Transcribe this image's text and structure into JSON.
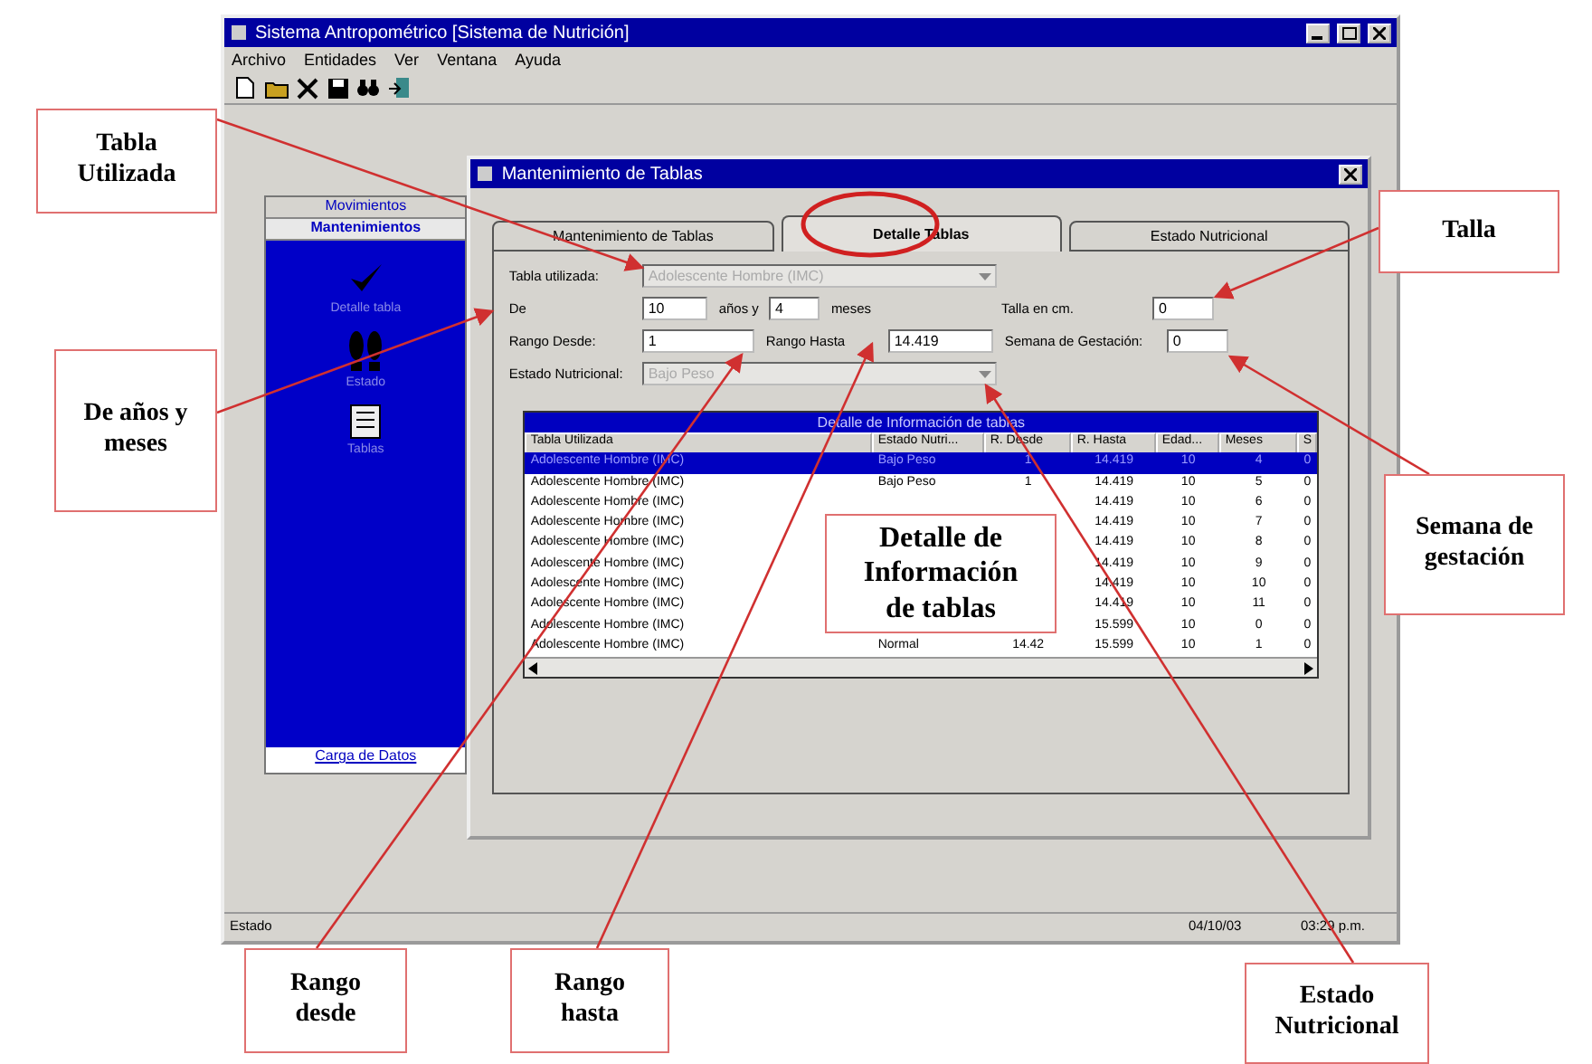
{
  "window": {
    "title": "Sistema Antropométrico [Sistema de Nutrición]"
  },
  "menu": [
    "Archivo",
    "Entidades",
    "Ver",
    "Ventana",
    "Ayuda"
  ],
  "sidebar": {
    "sections": [
      {
        "label": "Movimientos",
        "selected": false
      },
      {
        "label": "Mantenimientos",
        "selected": true
      }
    ],
    "items": [
      {
        "kind": "check",
        "label": "Detalle tabla"
      },
      {
        "kind": "feet",
        "label": "Estado"
      },
      {
        "kind": "sheet",
        "label": "Tablas"
      }
    ],
    "footer": "Carga de Datos"
  },
  "dialog": {
    "title": "Mantenimiento de Tablas",
    "tabs": [
      {
        "label": "Mantenimiento de Tablas",
        "selected": false
      },
      {
        "label": "Detalle Tablas",
        "selected": true
      },
      {
        "label": "Estado Nutricional",
        "selected": false
      }
    ],
    "form": {
      "tabla_label": "Tabla utilizada:",
      "tabla_value": "Adolescente Hombre (IMC)",
      "de_label": "De",
      "anios": "10",
      "anios_label": "años y",
      "meses": "4",
      "meses_label": "meses",
      "talla_label": "Talla en cm.",
      "talla": "0",
      "desde_label": "Rango Desde:",
      "desde": "1",
      "hasta_label": "Rango Hasta",
      "hasta": "14.419",
      "semana_label": "Semana de Gestación:",
      "semana": "0",
      "estado_label": "Estado Nutricional:",
      "estado_value": "Bajo Peso"
    },
    "grid": {
      "title": "Detalle de Información de tablas",
      "columns": [
        "Tabla Utilizada",
        "Estado Nutri...",
        "R. Desde",
        "R. Hasta",
        "Edad...",
        "Meses",
        "S"
      ],
      "rows": [
        {
          "selected": true,
          "cells": [
            "Adolescente Hombre (IMC)",
            "Bajo Peso",
            "1",
            "14.419",
            "10",
            "4",
            "0"
          ]
        },
        {
          "selected": false,
          "cells": [
            "Adolescente Hombre (IMC)",
            "Bajo Peso",
            "1",
            "14.419",
            "10",
            "5",
            "0"
          ]
        },
        {
          "selected": false,
          "cells": [
            "Adolescente Hombre (IMC)",
            null,
            null,
            "14.419",
            "10",
            "6",
            "0"
          ]
        },
        {
          "selected": false,
          "cells": [
            "Adolescente Hombre (IMC)",
            null,
            null,
            "14.419",
            "10",
            "7",
            "0"
          ]
        },
        {
          "selected": false,
          "cells": [
            "Adolescente Hombre (IMC)",
            null,
            null,
            "14.419",
            "10",
            "8",
            "0"
          ]
        },
        {
          "selected": false,
          "cells": [
            "Adolescente Hombre (IMC)",
            null,
            null,
            "14.419",
            "10",
            "9",
            "0"
          ]
        },
        {
          "selected": false,
          "cells": [
            "Adolescente Hombre (IMC)",
            null,
            null,
            "14.419",
            "10",
            "10",
            "0"
          ]
        },
        {
          "selected": false,
          "cells": [
            "Adolescente Hombre (IMC)",
            null,
            null,
            "14.419",
            "10",
            "11",
            "0"
          ]
        },
        {
          "selected": false,
          "cells": [
            "Adolescente Hombre (IMC)",
            null,
            null,
            "15.599",
            "10",
            "0",
            "0"
          ]
        },
        {
          "selected": false,
          "cells": [
            "Adolescente Hombre (IMC)",
            "Normal",
            "14.42",
            "15.599",
            "10",
            "1",
            "0"
          ]
        }
      ]
    }
  },
  "status_bar": [
    "Estado",
    "04/10/03",
    "03:29 p.m."
  ],
  "callouts": [
    "Tabla Utilizada",
    "De años y meses",
    "Talla",
    "Semana de gestación",
    "Rango desde",
    "Rango hasta",
    "Estado Nutricional",
    "Detalle de Información de tablas"
  ]
}
